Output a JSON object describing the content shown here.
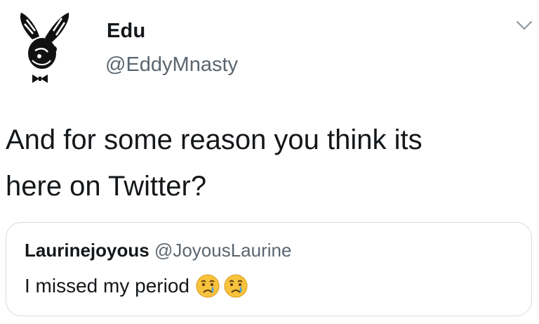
{
  "tweet": {
    "display_name": "Edu",
    "handle": "@EddyMnasty",
    "avatar_icon": "bunny-logo-icon",
    "menu_icon": "chevron-down-icon",
    "text_line1": "And for some reason you think its",
    "text_line2": "here on Twitter?"
  },
  "quoted_tweet": {
    "display_name": "Laurinejoyous",
    "handle": "@JoyousLaurine",
    "text": "I missed my period",
    "emojis": [
      "crying-face-emoji",
      "crying-face-emoji"
    ]
  },
  "colors": {
    "text": "#14171a",
    "secondary_text": "#5b6670",
    "border": "#d6dde3",
    "emoji_fill": "#f7c23c",
    "tear": "#4aa3df"
  }
}
